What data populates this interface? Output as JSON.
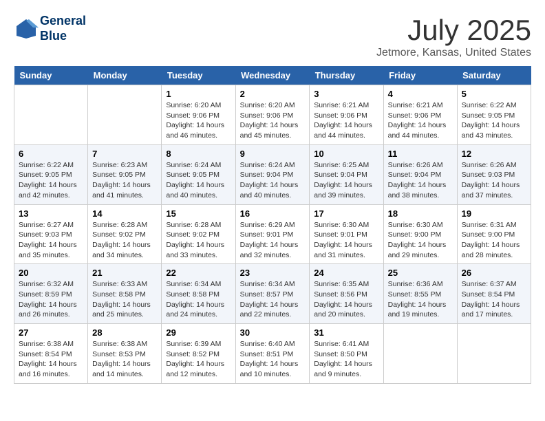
{
  "header": {
    "logo_line1": "General",
    "logo_line2": "Blue",
    "month": "July 2025",
    "location": "Jetmore, Kansas, United States"
  },
  "weekdays": [
    "Sunday",
    "Monday",
    "Tuesday",
    "Wednesday",
    "Thursday",
    "Friday",
    "Saturday"
  ],
  "weeks": [
    [
      {
        "day": "",
        "info": ""
      },
      {
        "day": "",
        "info": ""
      },
      {
        "day": "1",
        "info": "Sunrise: 6:20 AM\nSunset: 9:06 PM\nDaylight: 14 hours and 46 minutes."
      },
      {
        "day": "2",
        "info": "Sunrise: 6:20 AM\nSunset: 9:06 PM\nDaylight: 14 hours and 45 minutes."
      },
      {
        "day": "3",
        "info": "Sunrise: 6:21 AM\nSunset: 9:06 PM\nDaylight: 14 hours and 44 minutes."
      },
      {
        "day": "4",
        "info": "Sunrise: 6:21 AM\nSunset: 9:06 PM\nDaylight: 14 hours and 44 minutes."
      },
      {
        "day": "5",
        "info": "Sunrise: 6:22 AM\nSunset: 9:05 PM\nDaylight: 14 hours and 43 minutes."
      }
    ],
    [
      {
        "day": "6",
        "info": "Sunrise: 6:22 AM\nSunset: 9:05 PM\nDaylight: 14 hours and 42 minutes."
      },
      {
        "day": "7",
        "info": "Sunrise: 6:23 AM\nSunset: 9:05 PM\nDaylight: 14 hours and 41 minutes."
      },
      {
        "day": "8",
        "info": "Sunrise: 6:24 AM\nSunset: 9:05 PM\nDaylight: 14 hours and 40 minutes."
      },
      {
        "day": "9",
        "info": "Sunrise: 6:24 AM\nSunset: 9:04 PM\nDaylight: 14 hours and 40 minutes."
      },
      {
        "day": "10",
        "info": "Sunrise: 6:25 AM\nSunset: 9:04 PM\nDaylight: 14 hours and 39 minutes."
      },
      {
        "day": "11",
        "info": "Sunrise: 6:26 AM\nSunset: 9:04 PM\nDaylight: 14 hours and 38 minutes."
      },
      {
        "day": "12",
        "info": "Sunrise: 6:26 AM\nSunset: 9:03 PM\nDaylight: 14 hours and 37 minutes."
      }
    ],
    [
      {
        "day": "13",
        "info": "Sunrise: 6:27 AM\nSunset: 9:03 PM\nDaylight: 14 hours and 35 minutes."
      },
      {
        "day": "14",
        "info": "Sunrise: 6:28 AM\nSunset: 9:02 PM\nDaylight: 14 hours and 34 minutes."
      },
      {
        "day": "15",
        "info": "Sunrise: 6:28 AM\nSunset: 9:02 PM\nDaylight: 14 hours and 33 minutes."
      },
      {
        "day": "16",
        "info": "Sunrise: 6:29 AM\nSunset: 9:01 PM\nDaylight: 14 hours and 32 minutes."
      },
      {
        "day": "17",
        "info": "Sunrise: 6:30 AM\nSunset: 9:01 PM\nDaylight: 14 hours and 31 minutes."
      },
      {
        "day": "18",
        "info": "Sunrise: 6:30 AM\nSunset: 9:00 PM\nDaylight: 14 hours and 29 minutes."
      },
      {
        "day": "19",
        "info": "Sunrise: 6:31 AM\nSunset: 9:00 PM\nDaylight: 14 hours and 28 minutes."
      }
    ],
    [
      {
        "day": "20",
        "info": "Sunrise: 6:32 AM\nSunset: 8:59 PM\nDaylight: 14 hours and 26 minutes."
      },
      {
        "day": "21",
        "info": "Sunrise: 6:33 AM\nSunset: 8:58 PM\nDaylight: 14 hours and 25 minutes."
      },
      {
        "day": "22",
        "info": "Sunrise: 6:34 AM\nSunset: 8:58 PM\nDaylight: 14 hours and 24 minutes."
      },
      {
        "day": "23",
        "info": "Sunrise: 6:34 AM\nSunset: 8:57 PM\nDaylight: 14 hours and 22 minutes."
      },
      {
        "day": "24",
        "info": "Sunrise: 6:35 AM\nSunset: 8:56 PM\nDaylight: 14 hours and 20 minutes."
      },
      {
        "day": "25",
        "info": "Sunrise: 6:36 AM\nSunset: 8:55 PM\nDaylight: 14 hours and 19 minutes."
      },
      {
        "day": "26",
        "info": "Sunrise: 6:37 AM\nSunset: 8:54 PM\nDaylight: 14 hours and 17 minutes."
      }
    ],
    [
      {
        "day": "27",
        "info": "Sunrise: 6:38 AM\nSunset: 8:54 PM\nDaylight: 14 hours and 16 minutes."
      },
      {
        "day": "28",
        "info": "Sunrise: 6:38 AM\nSunset: 8:53 PM\nDaylight: 14 hours and 14 minutes."
      },
      {
        "day": "29",
        "info": "Sunrise: 6:39 AM\nSunset: 8:52 PM\nDaylight: 14 hours and 12 minutes."
      },
      {
        "day": "30",
        "info": "Sunrise: 6:40 AM\nSunset: 8:51 PM\nDaylight: 14 hours and 10 minutes."
      },
      {
        "day": "31",
        "info": "Sunrise: 6:41 AM\nSunset: 8:50 PM\nDaylight: 14 hours and 9 minutes."
      },
      {
        "day": "",
        "info": ""
      },
      {
        "day": "",
        "info": ""
      }
    ]
  ]
}
